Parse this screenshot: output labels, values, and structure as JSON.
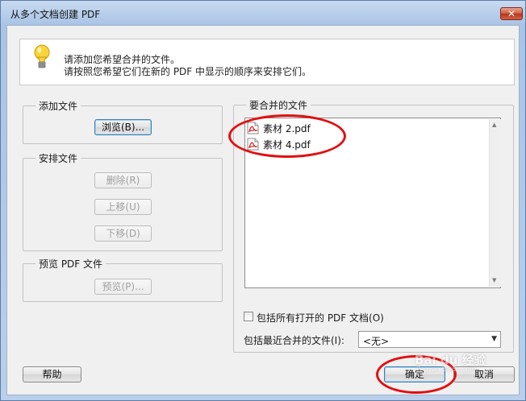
{
  "window": {
    "title": "从多个文档创建 PDF",
    "close_label": "✕"
  },
  "instruction": {
    "line1": "请添加您希望合并的文件。",
    "line2": "请按照您希望它们在新的 PDF 中显示的顺序来安排它们。"
  },
  "add_files": {
    "label": "添加文件",
    "browse_label": "浏览(B)..."
  },
  "arrange_files": {
    "label": "安排文件",
    "delete_label": "删除(R)",
    "move_up_label": "上移(U)",
    "move_down_label": "下移(D)"
  },
  "preview_pdf": {
    "label": "预览 PDF 文件",
    "preview_label": "预览(P)..."
  },
  "files_to_merge": {
    "label": "要合并的文件",
    "files": [
      {
        "name": "素材 2.pdf",
        "icon": "pdf-file-icon"
      },
      {
        "name": "素材 4.pdf",
        "icon": "pdf-file-icon"
      }
    ]
  },
  "include_open": {
    "label": "包括所有打开的 PDF 文档(O)",
    "checked": false
  },
  "recent": {
    "label": "包括最近合并的文件(I):",
    "value": "<无>"
  },
  "footer": {
    "help_label": "帮助",
    "ok_label": "确定",
    "cancel_label": "取消"
  },
  "watermark": {
    "text": "Bai du 经验",
    "sub": "jingyan.baidu.com"
  },
  "colors": {
    "annotation_red": "#e11010",
    "accent_blue": "#3c7fb1"
  }
}
